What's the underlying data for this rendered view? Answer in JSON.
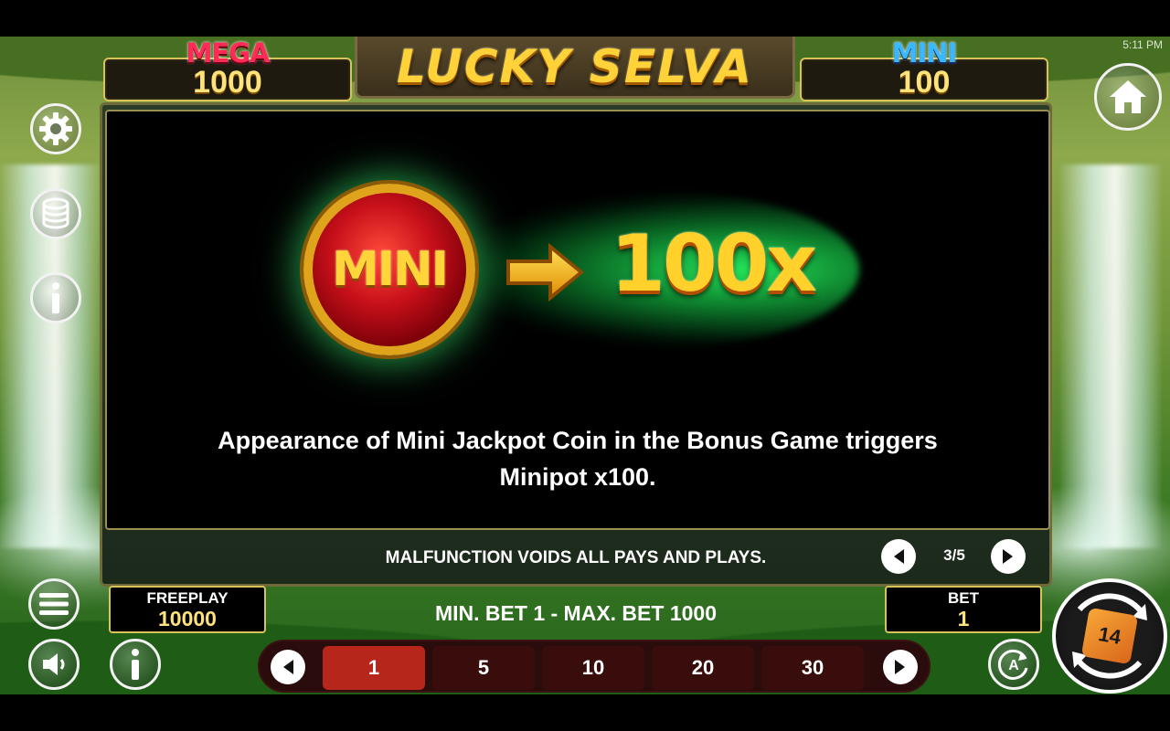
{
  "status_bar": {
    "time": "5:11 PM"
  },
  "game": {
    "title": "LUCKY SELVA"
  },
  "jackpots": {
    "mega": {
      "label": "MEGA",
      "value": "1000"
    },
    "mini": {
      "label": "MINI",
      "value": "100"
    }
  },
  "info_page": {
    "coin_label": "MINI",
    "multiplier": "100x",
    "description_line1": "Appearance of Mini Jackpot Coin in the Bonus Game triggers",
    "description_line2": "Minipot x100.",
    "disclaimer": "MALFUNCTION VOIDS ALL PAYS AND PLAYS.",
    "page_indicator": "3/5"
  },
  "freeplay": {
    "label": "FREEPLAY",
    "value": "10000"
  },
  "bet": {
    "label": "BET",
    "value": "1",
    "range_text": "MIN. BET 1 - MAX. BET 1000"
  },
  "bet_options": [
    "1",
    "5",
    "10",
    "20",
    "30"
  ],
  "bet_selected_index": 0,
  "auto_label": "A",
  "spin_logo": "14",
  "icons": {
    "settings": "gear-icon",
    "coins": "coin-stack-icon",
    "info": "info-icon",
    "home": "home-icon",
    "menu": "hamburger-menu-icon",
    "sound": "speaker-icon",
    "auto": "autoplay-icon",
    "arrow": "arrow-right-icon"
  },
  "colors": {
    "accent_gold": "#ffd12a",
    "frame_border": "#d8c25a",
    "bet_selected": "#b7261a",
    "mega_red": "#ff2a55",
    "mini_blue": "#3ab8ff"
  }
}
